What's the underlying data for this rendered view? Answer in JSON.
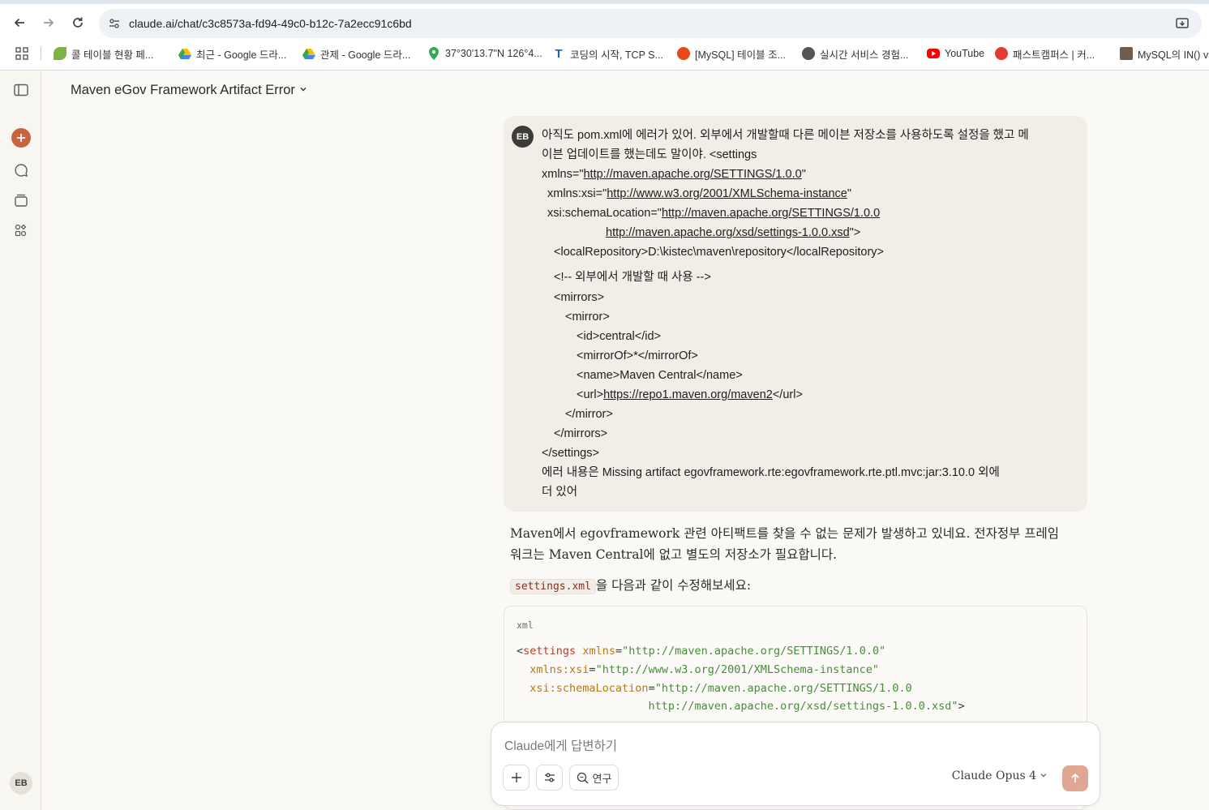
{
  "browser": {
    "url": "claude.ai/chat/c3c8573a-fd94-49c0-b12c-7a2ecc91c6bd",
    "bookmarks": [
      {
        "label": "콜 테이블 현황 페...",
        "icon": "leaf-icon",
        "color": "#7cb342"
      },
      {
        "label": "최근 - Google 드라...",
        "icon": "google-drive-icon",
        "color": "#1e88e5"
      },
      {
        "label": "관제 - Google 드라...",
        "icon": "google-drive-icon",
        "color": "#1e88e5"
      },
      {
        "label": "37°30'13.7\"N 126°4...",
        "icon": "map-pin-icon",
        "color": "#34a853"
      },
      {
        "label": "코딩의 시작, TCP S...",
        "icon": "tcp-school-icon",
        "color": "#1565c0"
      },
      {
        "label": "[MySQL] 테이블 조...",
        "icon": "velog-icon",
        "color": "#e64a19"
      },
      {
        "label": "실시간 서비스 경험...",
        "icon": "globe-icon",
        "color": "#555555"
      },
      {
        "label": "YouTube",
        "icon": "youtube-icon",
        "color": "#ff0000"
      },
      {
        "label": "패스트캠퍼스 | 커...",
        "icon": "fastcampus-icon",
        "color": "#e53935"
      },
      {
        "label": "MySQL의 IN() v",
        "icon": "blog-thumbnail-icon",
        "color": "#6d5d4b"
      }
    ]
  },
  "header": {
    "title": "Maven eGov Framework Artifact Error"
  },
  "user": {
    "initials": "EB"
  },
  "user_message": {
    "lines": [
      "아직도 pom.xml에 에러가 있어. 외부에서 개발할때 다른 메이븐 저장소를 사용하도록 설정을 했고 메",
      "이븐 업데이트를 했는데도 말이야. <settings",
      "xmlns=\"",
      "http://maven.apache.org/SETTINGS/1.0.0",
      "\"",
      "xmlns:xsi=\"",
      "http://www.w3.org/2001/XMLSchema-instance",
      "\"",
      "xsi:schemaLocation=\"",
      "http://maven.apache.org/SETTINGS/1.0.0",
      "http://maven.apache.org/xsd/settings-1.0.0.xsd",
      "\">",
      "<localRepository>D:\\kistec\\maven\\repository</localRepository>",
      "<!-- 외부에서 개발할 때 사용 -->",
      "<mirrors>",
      "<mirror>",
      "<id>central</id>",
      "<mirrorOf>*</mirrorOf>",
      "<name>Maven Central</name>",
      "<url>",
      "https://repo1.maven.org/maven2",
      "</url>",
      "</mirror>",
      "</mirrors>",
      "</settings>",
      "에러 내용은 Missing artifact egovframework.rte:egovframework.rte.ptl.mvc:jar:3.10.0 외에",
      "더 있어"
    ]
  },
  "assistant": {
    "para1_line1": "Maven에서 egovframework 관련 아티팩트를 찾을 수 없는 문제가 발생하고 있네요. 전자정부 프레임",
    "para1_line2": "워크는 Maven Central에 없고 별도의 저장소가 필요합니다.",
    "code_inline": "settings.xml",
    "para2_rest": "을 다음과 같이 수정해보세요:",
    "code_language": "xml",
    "code": {
      "l1": [
        "<",
        "settings",
        " ",
        "xmlns",
        "=",
        "\"http://maven.apache.org/SETTINGS/1.0.0\""
      ],
      "l2": [
        "  ",
        "xmlns:xsi",
        "=",
        "\"http://www.w3.org/2001/XMLSchema-instance\""
      ],
      "l3": [
        "  ",
        "xsi:schemaLocation",
        "=",
        "\"http://maven.apache.org/SETTINGS/1.0.0"
      ],
      "l4": [
        "                    http://maven.apache.org/xsd/settings-1.0.0.xsd\"",
        ">"
      ]
    }
  },
  "composer": {
    "placeholder": "Claude에게 답변하기",
    "research_label": "연구",
    "model": "Claude Opus 4"
  },
  "colors": {
    "accent": "#c96442",
    "send_disabled": "#e1a795"
  }
}
